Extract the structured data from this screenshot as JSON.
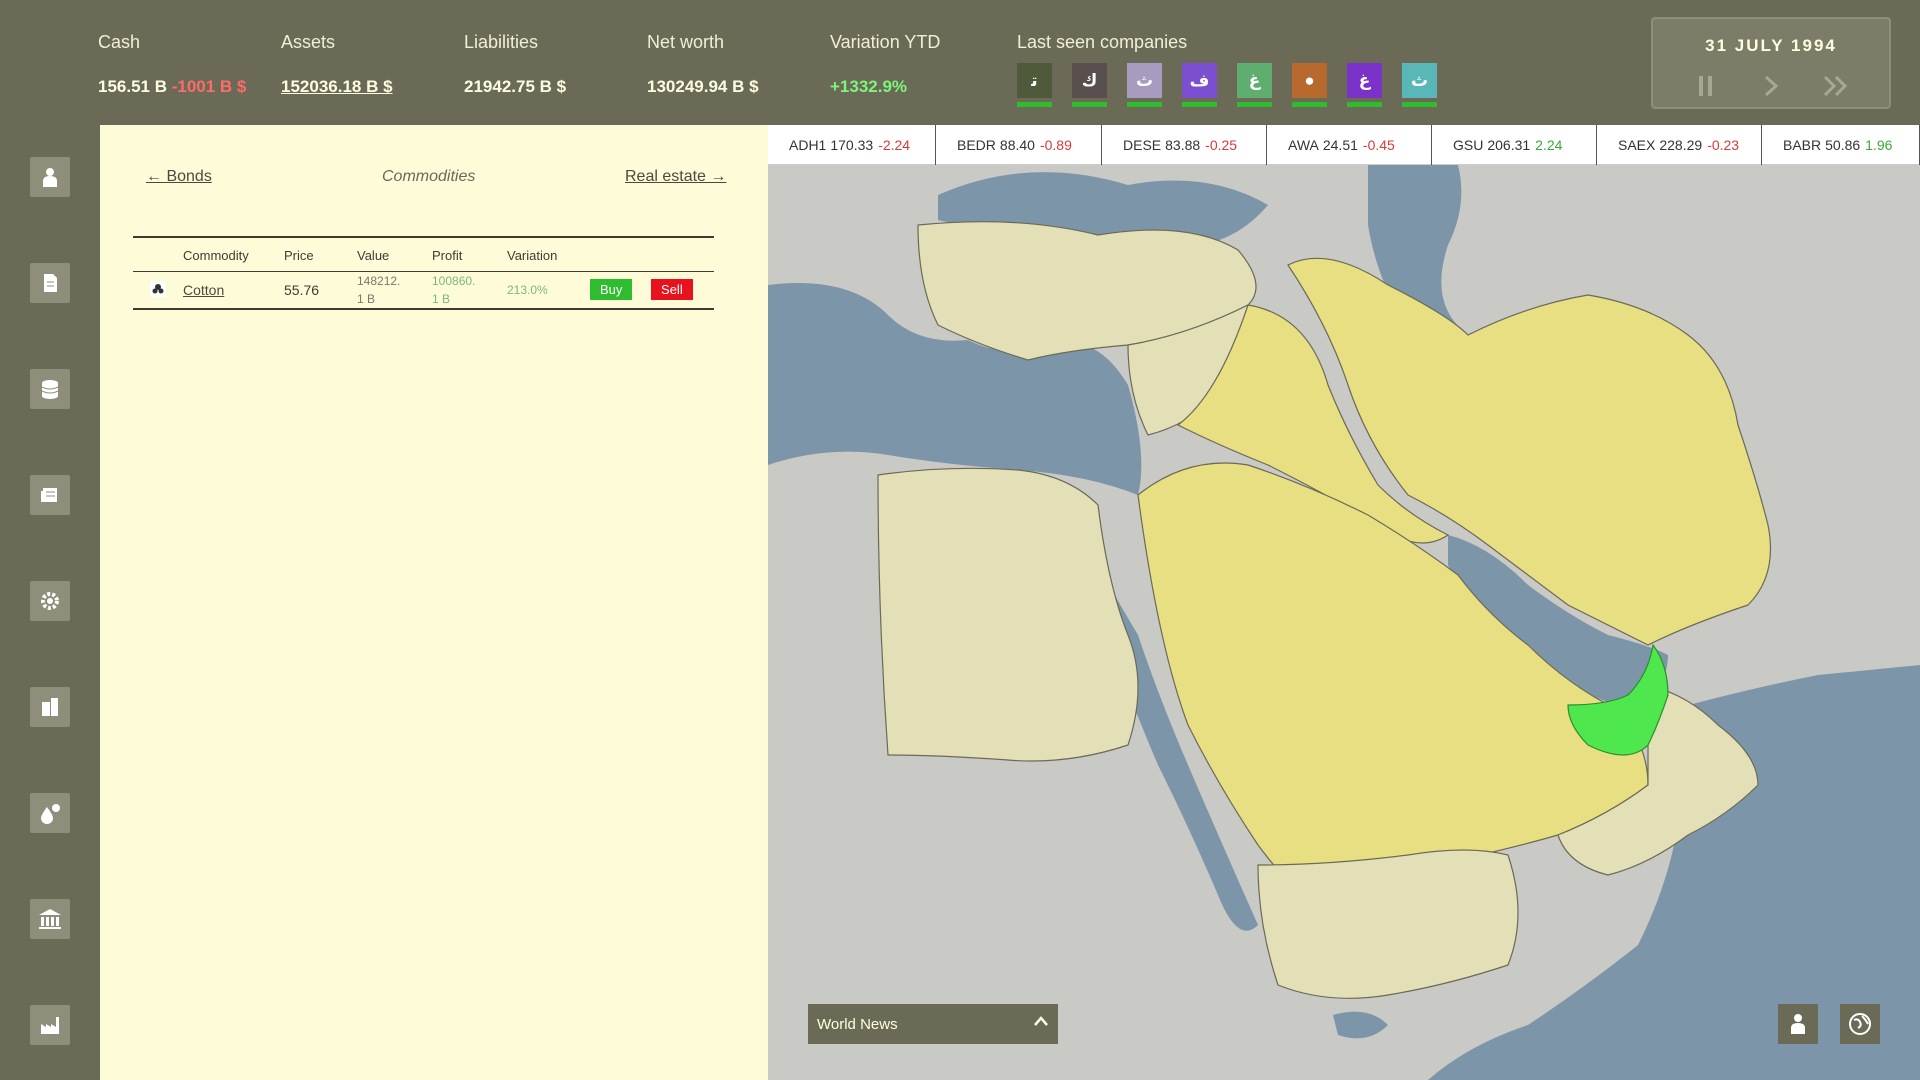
{
  "header": {
    "cash": {
      "label": "Cash",
      "value": "156.51 B",
      "change": "-1001 B $"
    },
    "assets": {
      "label": "Assets",
      "value": "152036.18 B $"
    },
    "liabilities": {
      "label": "Liabilities",
      "value": "21942.75 B $"
    },
    "net_worth": {
      "label": "Net worth",
      "value": "130249.94 B $"
    },
    "variation": {
      "label": "Variation YTD",
      "value": "+1332.9%"
    },
    "companies": {
      "label": "Last seen companies",
      "items": [
        {
          "glyph": "ﺗ",
          "color": "#4f5a3a"
        },
        {
          "glyph": "ك",
          "color": "#5a4f4f"
        },
        {
          "glyph": "ث",
          "color": "#a79bbf"
        },
        {
          "glyph": "ف",
          "color": "#7b4fd0"
        },
        {
          "glyph": "غ",
          "color": "#5fae6f"
        },
        {
          "glyph": "●",
          "color": "#b86a2e"
        },
        {
          "glyph": "غ",
          "color": "#7b32c8"
        },
        {
          "glyph": "ث",
          "color": "#5ab7b7"
        }
      ]
    },
    "date": "31 JULY 1994"
  },
  "sidebar": {
    "items": [
      {
        "icon": "person-icon"
      },
      {
        "icon": "document-icon"
      },
      {
        "icon": "database-icon"
      },
      {
        "icon": "newspaper-icon"
      },
      {
        "icon": "gear-icon"
      },
      {
        "icon": "buildings-icon"
      },
      {
        "icon": "oil-drop-icon"
      },
      {
        "icon": "bank-icon"
      },
      {
        "icon": "factory-icon"
      }
    ]
  },
  "panel": {
    "nav_prev": "← Bonds",
    "nav_current": "Commodities",
    "nav_next": "Real estate →",
    "columns": [
      "Commodity",
      "Price",
      "Value",
      "Profit",
      "Variation"
    ],
    "rows": [
      {
        "name": "Cotton",
        "price": "55.76",
        "value_l1": "148212.",
        "value_l2": "1 B",
        "profit_l1": "100860.",
        "profit_l2": "1 B",
        "variation": "213.0%",
        "buy": "Buy",
        "sell": "Sell"
      }
    ]
  },
  "ticker": [
    {
      "sym": "ADH1",
      "price": "170.33",
      "chg": "-2.24",
      "dir": "down"
    },
    {
      "sym": "BEDR",
      "price": "88.40",
      "chg": "-0.89",
      "dir": "down"
    },
    {
      "sym": "DESE",
      "price": "83.88",
      "chg": "-0.25",
      "dir": "down"
    },
    {
      "sym": "AWA",
      "price": "24.51",
      "chg": "-0.45",
      "dir": "down"
    },
    {
      "sym": "GSU",
      "price": "206.31",
      "chg": "2.24",
      "dir": "up"
    },
    {
      "sym": "SAEX",
      "price": "228.29",
      "chg": "-0.23",
      "dir": "down"
    },
    {
      "sym": "BABR",
      "price": "50.86",
      "chg": "1.96",
      "dir": "up"
    }
  ],
  "map": {
    "world_news": "World News"
  },
  "colors": {
    "topbar": "#6b6a57",
    "panel": "#fefcd8",
    "water": "#7d95a8",
    "land_pale": "#e3dfb6",
    "land_yellow": "#e7df82",
    "land_owned": "#4ee84e"
  }
}
